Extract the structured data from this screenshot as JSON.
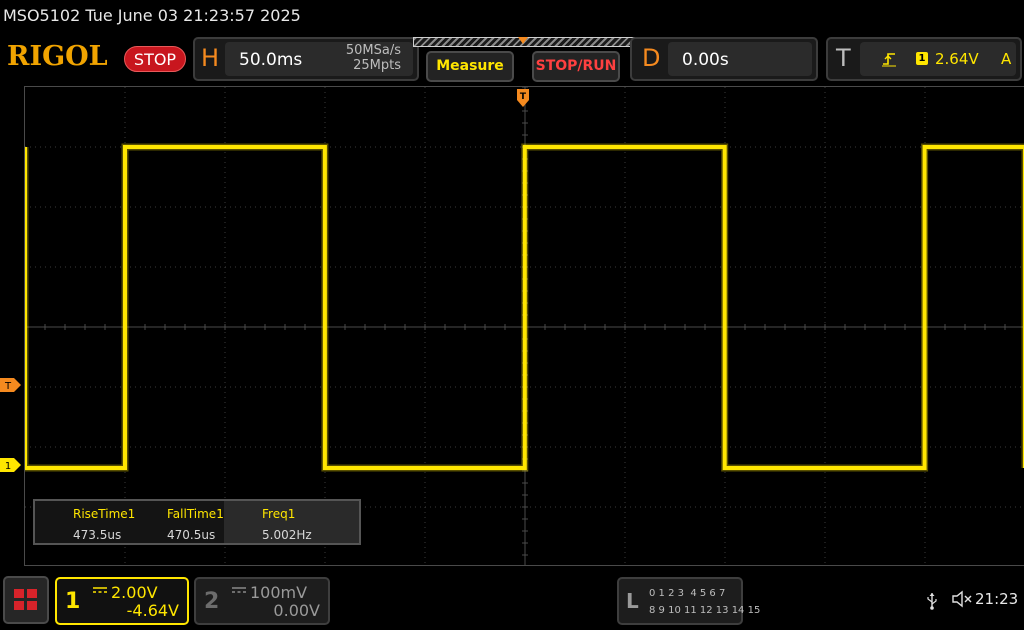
{
  "titlebar": {
    "text": "MSO5102  Tue June 03 21:23:57 2025"
  },
  "brand": {
    "logo": "RIGOL",
    "run_status": "STOP"
  },
  "horizontal": {
    "letter": "H",
    "timebase": "50.0ms",
    "sample_rate": "50MSa/s",
    "memory_depth": "25Mpts"
  },
  "toolbar": {
    "measure_label": "Measure",
    "stoprun_label": "STOP/RUN"
  },
  "delay": {
    "letter": "D",
    "value": "0.00s"
  },
  "trigger": {
    "letter": "T",
    "source": "1",
    "level": "2.64V",
    "mode": "A",
    "edge_icon": "rising-edge-icon",
    "marker_label": "T"
  },
  "channel1": {
    "number": "1",
    "scale": "2.00V",
    "offset": "-4.64V",
    "color": "#ffe600",
    "marker_label": "1",
    "coupling_icon": "dc-coupling-icon"
  },
  "channel2": {
    "number": "2",
    "scale": "100mV",
    "offset": "0.00V",
    "color": "#9a9a9a",
    "coupling_icon": "dc-coupling-icon"
  },
  "measurements": [
    {
      "name": "RiseTime1",
      "value": "473.5us"
    },
    {
      "name": "FallTime1",
      "value": "470.5us"
    },
    {
      "name": "Freq1",
      "value": "5.002Hz"
    }
  ],
  "logic_analyzer": {
    "letter": "L",
    "row1": "0 1 2 3  4 5 6 7",
    "row2": "8 9 10 11 12 13 14 15"
  },
  "status": {
    "clock": "21:23",
    "usb_icon": "usb-icon",
    "speaker_icon": "speaker-muted-icon"
  },
  "menu": {
    "icon": "menu-grid-icon"
  },
  "colors": {
    "accent_orange": "#f58a1f",
    "trace_yellow": "#ffe600",
    "stop_red": "#c8161e"
  },
  "waveform": {
    "type": "square",
    "frequency": "5.002Hz",
    "timebase_per_div": "50.0ms",
    "volts_per_div": "2.00V",
    "high_div": 3.0,
    "low_div": -2.35,
    "first_rising_edge_ms": -200,
    "period_ms": 199.9,
    "duty_percent": 50
  }
}
